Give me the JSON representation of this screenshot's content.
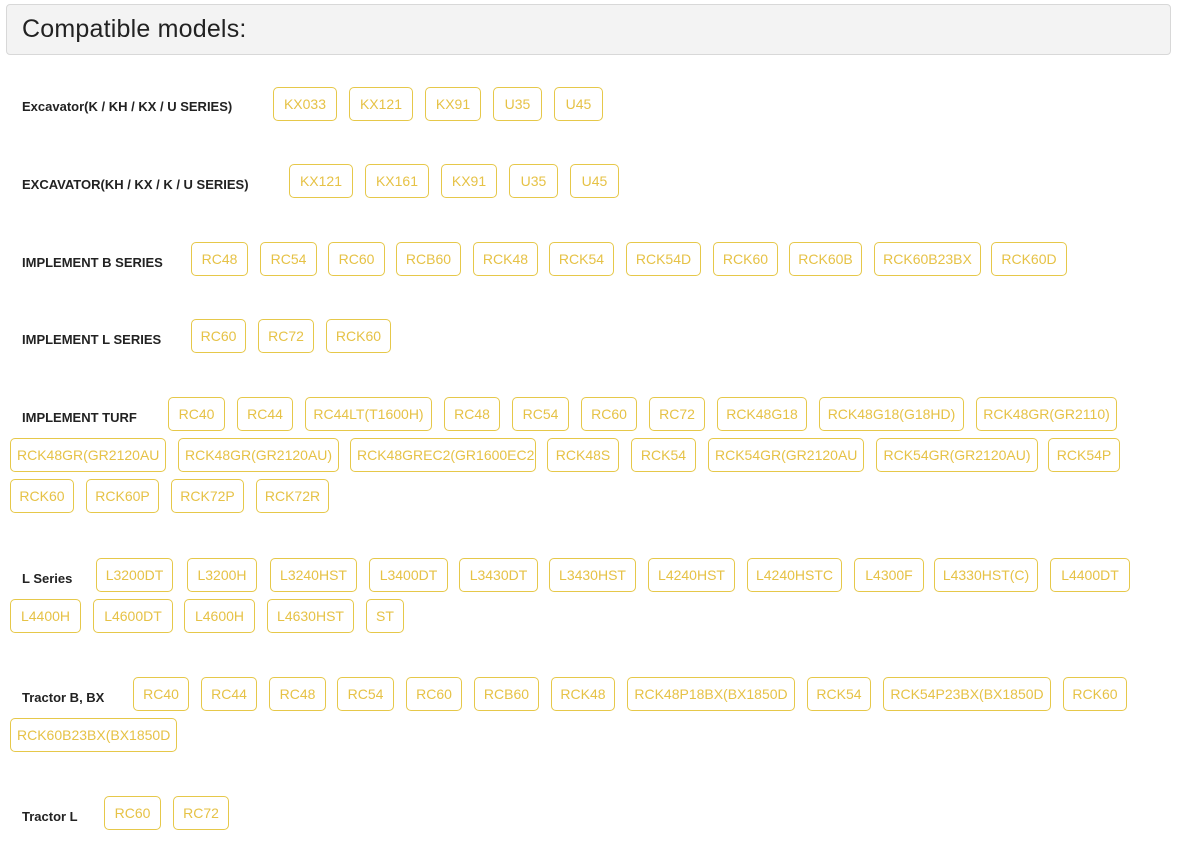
{
  "page": {
    "heading": "Compatible models:"
  },
  "groups": [
    {
      "label": "Excavator(K / KH / KX / U SERIES)",
      "models": [
        "KX033",
        "KX121",
        "KX91",
        "U35",
        "U45"
      ]
    },
    {
      "label": "EXCAVATOR(KH / KX / K / U SERIES)",
      "models": [
        "KX121",
        "KX161",
        "KX91",
        "U35",
        "U45"
      ]
    },
    {
      "label": "IMPLEMENT B SERIES",
      "models": [
        "RC48",
        "RC54",
        "RC60",
        "RCB60",
        "RCK48",
        "RCK54",
        "RCK54D",
        "RCK60",
        "RCK60B",
        "RCK60B23BX",
        "RCK60D"
      ]
    },
    {
      "label": "IMPLEMENT L SERIES",
      "models": [
        "RC60",
        "RC72",
        "RCK60"
      ]
    },
    {
      "label": "IMPLEMENT TURF",
      "models": [
        "RC40",
        "RC44",
        "RC44LT(T1600H)",
        "RC48",
        "RC54",
        "RC60",
        "RC72",
        "RCK48G18",
        "RCK48G18(G18HD)",
        "RCK48GR(GR2110)",
        "RCK48GR(GR2120AU",
        "RCK48GR(GR2120AU)",
        "RCK48GREC2(GR1600EC2",
        "RCK48S",
        "RCK54",
        "RCK54GR(GR2120AU",
        "RCK54GR(GR2120AU)",
        "RCK54P",
        "RCK60",
        "RCK60P",
        "RCK72P",
        "RCK72R"
      ]
    },
    {
      "label": "L Series",
      "models": [
        "L3200DT",
        "L3200H",
        "L3240HST",
        "L3400DT",
        "L3430DT",
        "L3430HST",
        "L4240HST",
        "L4240HSTC",
        "L4300F",
        "L4330HST(C)",
        "L4400DT",
        "L4400H",
        "L4600DT",
        "L4600H",
        "L4630HST",
        "ST"
      ]
    },
    {
      "label": "Tractor B, BX",
      "models": [
        "RC40",
        "RC44",
        "RC48",
        "RC54",
        "RC60",
        "RCB60",
        "RCK48",
        "RCK48P18BX(BX1850D",
        "RCK54",
        "RCK54P23BX(BX1850D",
        "RCK60",
        "RCK60B23BX(BX1850D"
      ]
    },
    {
      "label": "Tractor L",
      "models": [
        "RC60",
        "RC72"
      ]
    }
  ],
  "colors": {
    "chip_border": "#e6c84a",
    "chip_text": "#e6c246",
    "header_bg": "#f3f3f3"
  }
}
